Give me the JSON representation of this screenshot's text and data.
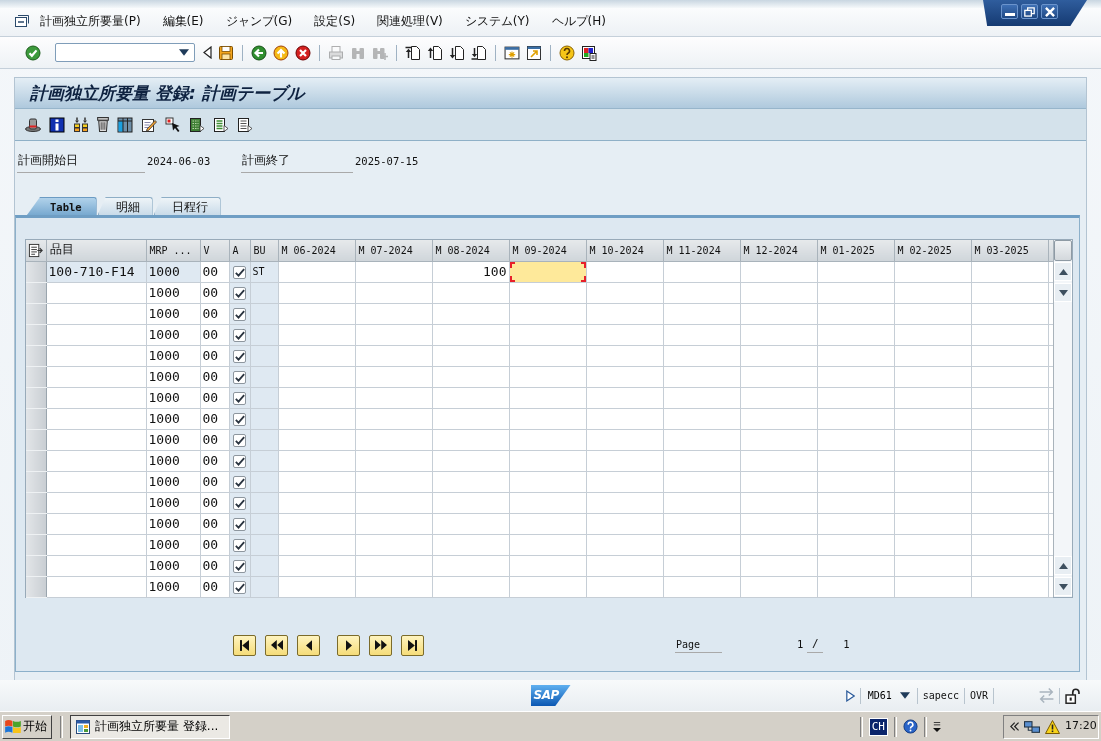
{
  "menu_bar": {
    "items": [
      "計画独立所要量(P)",
      "編集(E)",
      "ジャンプ(G)",
      "設定(S)",
      "関連処理(V)",
      "システム(Y)",
      "ヘルプ(H)"
    ]
  },
  "toolbar": {
    "groups": [
      [
        {
          "kind": "enter",
          "disabled": false
        },
        {
          "kind": "command"
        },
        {
          "kind": "collapse",
          "disabled": false
        },
        {
          "kind": "save",
          "disabled": false
        }
      ],
      [
        {
          "kind": "back",
          "disabled": false
        },
        {
          "kind": "exit",
          "disabled": false
        },
        {
          "kind": "cancel",
          "disabled": false
        }
      ],
      [
        {
          "kind": "print",
          "disabled": true
        },
        {
          "kind": "find",
          "disabled": true
        },
        {
          "kind": "findnext",
          "disabled": true
        }
      ],
      [
        {
          "kind": "first",
          "disabled": false
        },
        {
          "kind": "previous",
          "disabled": false
        },
        {
          "kind": "next",
          "disabled": false
        },
        {
          "kind": "last",
          "disabled": false
        }
      ],
      [
        {
          "kind": "session",
          "disabled": false
        },
        {
          "kind": "shortcut",
          "disabled": false
        }
      ],
      [
        {
          "kind": "help",
          "disabled": false
        },
        {
          "kind": "layout",
          "disabled": false
        }
      ]
    ]
  },
  "title": "計画独立所要量 登録: 計画テーブル",
  "application_toolbar": [
    {
      "kind": "hat",
      "disabled": false
    },
    {
      "kind": "info",
      "disabled": false
    },
    {
      "kind": "hierarchy",
      "disabled": false
    },
    {
      "kind": "trash",
      "disabled": false
    },
    {
      "kind": "columns",
      "disabled": false
    },
    {
      "kind": "edit",
      "disabled": false
    },
    {
      "kind": "select",
      "disabled": false
    },
    {
      "kind": "greendoc",
      "disabled": false
    },
    {
      "kind": "stripedoc",
      "disabled": false
    },
    {
      "kind": "plaindoc",
      "disabled": false
    }
  ],
  "fields": [
    {
      "label": "計画開始日",
      "value": "2024-06-03"
    },
    {
      "label": "計画終了",
      "value": "2025-07-15"
    }
  ],
  "tabs": [
    {
      "label": "Table",
      "selected": true
    },
    {
      "label": "明細",
      "selected": false
    },
    {
      "label": "日程行",
      "selected": false
    }
  ],
  "table": {
    "columns": [
      {
        "label": "品目",
        "readonly": false
      },
      {
        "label": "MRP ...",
        "readonly": false
      },
      {
        "label": "V",
        "readonly": false
      },
      {
        "label": "A",
        "readonly": true
      },
      {
        "label": "BU",
        "readonly": true
      }
    ],
    "month_columns": [
      "M 06-2024",
      "M 07-2024",
      "M 08-2024",
      "M 09-2024",
      "M 10-2024",
      "M 11-2024",
      "M 12-2024",
      "M 01-2025",
      "M 02-2025",
      "M 03-2025"
    ],
    "rows": [
      {
        "selected": false,
        "readonly": true,
        "material": "100-710-F14",
        "mrp_area": "1000",
        "version": "00",
        "active": true,
        "unit": "ST",
        "months": [
          {
            "selected": false
          },
          {
            "selected": false
          },
          {
            "value": "100",
            "selected": false
          },
          {
            "selected": true
          },
          {
            "selected": false
          },
          {
            "selected": false
          },
          {
            "selected": false
          },
          {
            "selected": false
          },
          {
            "selected": false
          },
          {
            "selected": false
          }
        ]
      },
      {
        "selected": false,
        "readonly": false,
        "mrp_area": "1000",
        "version": "00",
        "active": true
      },
      {
        "selected": false,
        "readonly": false,
        "mrp_area": "1000",
        "version": "00",
        "active": true
      },
      {
        "selected": false,
        "readonly": false,
        "mrp_area": "1000",
        "version": "00",
        "active": true
      },
      {
        "selected": false,
        "readonly": false,
        "mrp_area": "1000",
        "version": "00",
        "active": true
      },
      {
        "selected": false,
        "readonly": false,
        "mrp_area": "1000",
        "version": "00",
        "active": true
      },
      {
        "selected": false,
        "readonly": false,
        "mrp_area": "1000",
        "version": "00",
        "active": true
      },
      {
        "selected": false,
        "readonly": false,
        "mrp_area": "1000",
        "version": "00",
        "active": true
      },
      {
        "selected": false,
        "readonly": false,
        "mrp_area": "1000",
        "version": "00",
        "active": true
      },
      {
        "selected": false,
        "readonly": false,
        "mrp_area": "1000",
        "version": "00",
        "active": true
      },
      {
        "selected": false,
        "readonly": false,
        "mrp_area": "1000",
        "version": "00",
        "active": true
      },
      {
        "selected": false,
        "readonly": false,
        "mrp_area": "1000",
        "version": "00",
        "active": true
      },
      {
        "selected": false,
        "readonly": false,
        "mrp_area": "1000",
        "version": "00",
        "active": true
      },
      {
        "selected": false,
        "readonly": false,
        "mrp_area": "1000",
        "version": "00",
        "active": true
      },
      {
        "selected": false,
        "readonly": false,
        "mrp_area": "1000",
        "version": "00",
        "active": true
      },
      {
        "selected": false,
        "readonly": false,
        "mrp_area": "1000",
        "version": "00",
        "active": true
      }
    ]
  },
  "pager": {
    "buttons": [
      {
        "kind": "first",
        "disabled": false
      },
      {
        "kind": "fastback",
        "disabled": false
      },
      {
        "kind": "back",
        "disabled": false
      },
      {
        "kind": "forward",
        "disabled": false
      },
      {
        "kind": "fastforward",
        "disabled": false
      },
      {
        "kind": "last",
        "disabled": false
      }
    ],
    "label": "Page",
    "current": "1",
    "separator": "/",
    "total": "1"
  },
  "status_bar": {
    "logo": "SAP",
    "transaction": "MD61",
    "server": "sapecc",
    "mode": "OVR"
  },
  "taskbar": {
    "start": "开始",
    "tasks": [
      {
        "label": "計画独立所要量 登録...",
        "selected": true
      }
    ],
    "language": "CH",
    "clock": "17:20"
  }
}
